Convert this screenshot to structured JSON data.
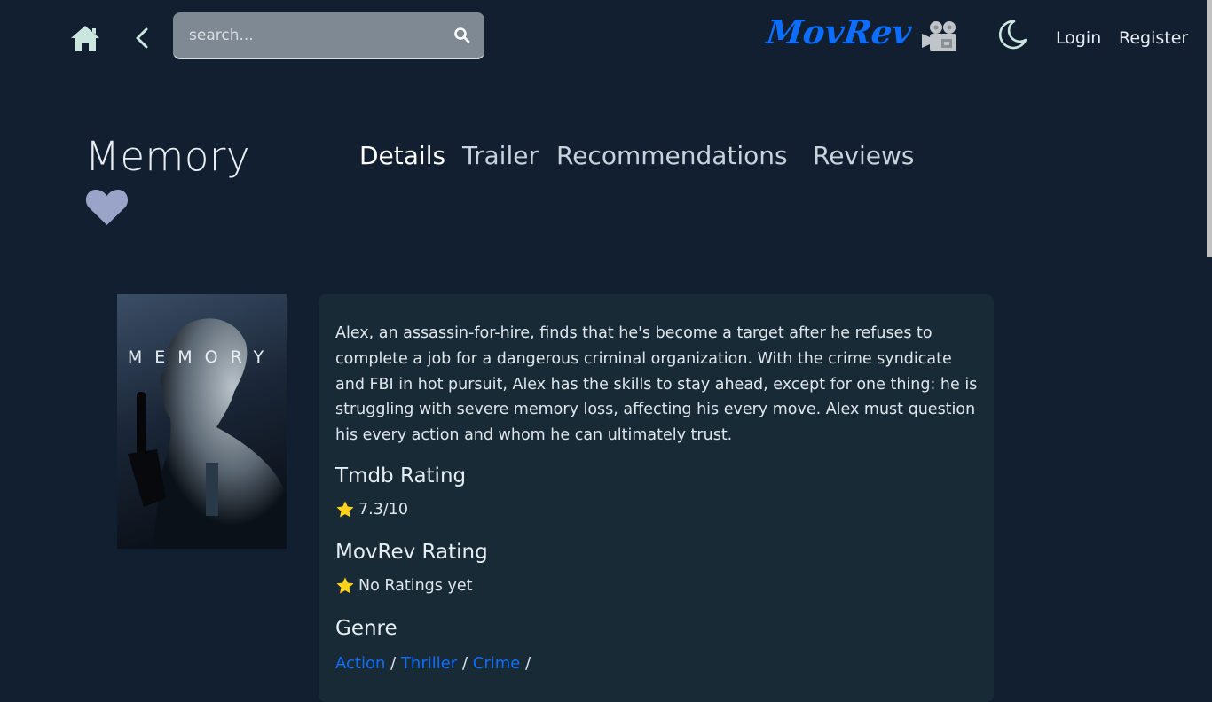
{
  "header": {
    "search_placeholder": "search...",
    "brand": "MovRev",
    "login_label": "Login",
    "register_label": "Register"
  },
  "movie": {
    "title": "Memory",
    "poster_text": "MEMORY",
    "overview": "Alex, an assassin-for-hire, finds that he's become a target after he refuses to complete a job for a dangerous criminal organization. With the crime syndicate and FBI in hot pursuit, Alex has the skills to stay ahead, except for one thing: he is struggling with severe memory loss, affecting his every move. Alex must question his every action and whom he can ultimately trust.",
    "tmdb_heading": "Tmdb Rating",
    "tmdb_value": "7.3/10",
    "movrev_heading": "MovRev Rating",
    "movrev_value": "No Ratings yet",
    "genre_heading": "Genre",
    "genres": [
      "Action",
      "Thriller",
      "Crime"
    ],
    "genre_separator": "/"
  },
  "tabs": [
    "Details",
    "Trailer",
    "Recommendations",
    "Reviews"
  ],
  "active_tab": "Details",
  "colors": {
    "background": "#111f31",
    "card": "#182a36",
    "accent": "#0d6efd",
    "star": "#ffd21e",
    "heart": "#9aa3c8",
    "icon": "#cbe6de"
  },
  "icons": {
    "home": "home-icon",
    "back": "chevron-left-icon",
    "search": "search-icon",
    "camera": "movie-camera-icon",
    "theme": "moon-icon",
    "favorite": "heart-icon",
    "rating": "star-icon"
  }
}
